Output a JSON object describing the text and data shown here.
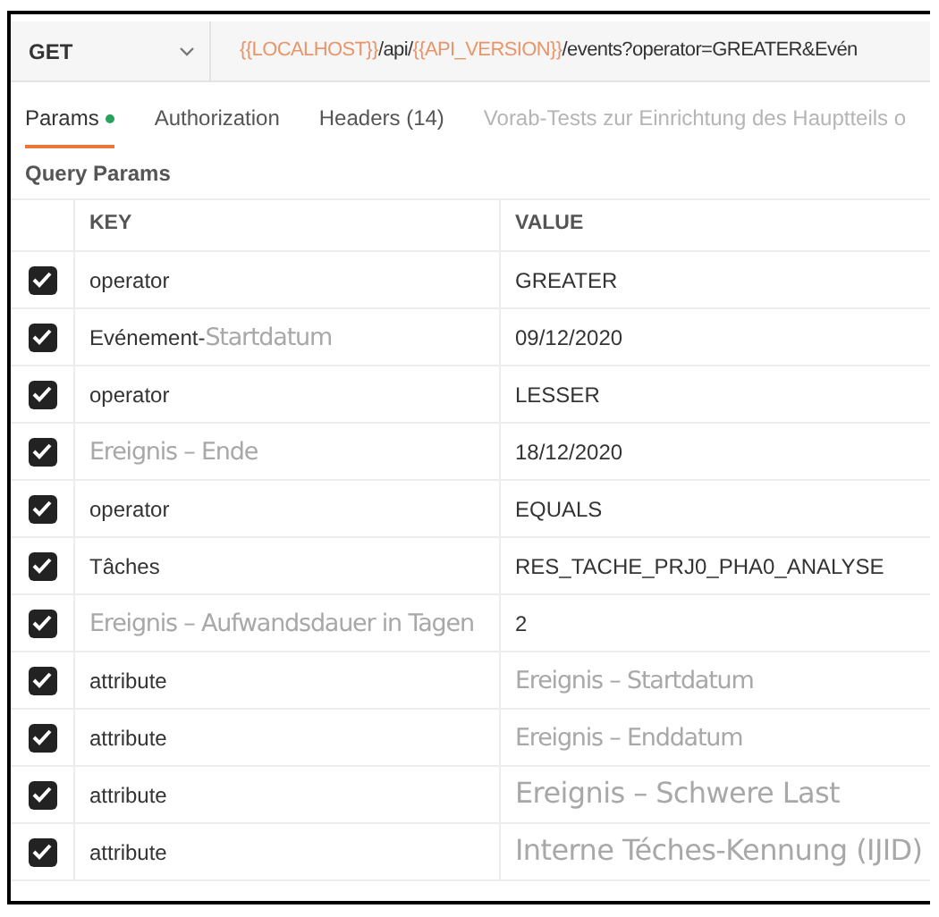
{
  "request": {
    "method": "GET",
    "url": [
      {
        "text": "{{LOCALHOST}}",
        "kind": "variable"
      },
      {
        "text": "/api/",
        "kind": "path"
      },
      {
        "text": "{{API_VERSION}}",
        "kind": "variable"
      },
      {
        "text": "/events?operator=GREATER&Evén",
        "kind": "path"
      }
    ]
  },
  "tabs": [
    {
      "label": "Params",
      "selected": true,
      "dot": true
    },
    {
      "label": "Authorization",
      "selected": false,
      "dot": false
    },
    {
      "label": "Headers (14)",
      "selected": false,
      "dot": false
    },
    {
      "label": "Vorab-Tests zur Einrichtung des Hauptteils o",
      "selected": false,
      "dot": false
    }
  ],
  "section_title": "Query Params",
  "table": {
    "columns": [
      "KEY",
      "VALUE"
    ],
    "rows": [
      {
        "checked": true,
        "key": [
          {
            "text": "operator",
            "kind": "plain"
          }
        ],
        "value": [
          {
            "text": "GREATER",
            "kind": "plain"
          }
        ]
      },
      {
        "checked": true,
        "key": [
          {
            "text": "Evénement-",
            "kind": "plain"
          },
          {
            "text": "Startdatum",
            "kind": "overlay"
          }
        ],
        "value": [
          {
            "text": "09/12/2020",
            "kind": "plain"
          }
        ]
      },
      {
        "checked": true,
        "key": [
          {
            "text": "operator",
            "kind": "plain"
          }
        ],
        "value": [
          {
            "text": "LESSER",
            "kind": "plain"
          }
        ]
      },
      {
        "checked": true,
        "key": [
          {
            "text": "Ereignis – Ende",
            "kind": "overlay"
          }
        ],
        "value": [
          {
            "text": "18/12/2020",
            "kind": "plain"
          }
        ]
      },
      {
        "checked": true,
        "key": [
          {
            "text": "operator",
            "kind": "plain"
          }
        ],
        "value": [
          {
            "text": "EQUALS",
            "kind": "plain"
          }
        ]
      },
      {
        "checked": true,
        "key": [
          {
            "text": "Tâches",
            "kind": "plain"
          }
        ],
        "value": [
          {
            "text": "RES_TACHE_PRJ0_PHA0_ANALYSE",
            "kind": "plain"
          }
        ]
      },
      {
        "checked": true,
        "key": [
          {
            "text": "Ereignis – Aufwandsdauer in Tagen",
            "kind": "overlay"
          }
        ],
        "value": [
          {
            "text": "2",
            "kind": "plain"
          }
        ]
      },
      {
        "checked": true,
        "key": [
          {
            "text": "attribute",
            "kind": "plain"
          }
        ],
        "value": [
          {
            "text": "Ereignis – Startdatum",
            "kind": "overlay"
          }
        ]
      },
      {
        "checked": true,
        "key": [
          {
            "text": "attribute",
            "kind": "plain"
          }
        ],
        "value": [
          {
            "text": "Ereignis – Enddatum",
            "kind": "overlay"
          }
        ]
      },
      {
        "checked": true,
        "key": [
          {
            "text": "attribute",
            "kind": "plain"
          }
        ],
        "value": [
          {
            "text": "Ereignis – Schwere Last",
            "kind": "overlay-large"
          }
        ]
      },
      {
        "checked": true,
        "key": [
          {
            "text": "attribute",
            "kind": "plain"
          }
        ],
        "value": [
          {
            "text": "Interne Téches-Kennung (IJID)",
            "kind": "overlay-large"
          }
        ]
      }
    ]
  }
}
